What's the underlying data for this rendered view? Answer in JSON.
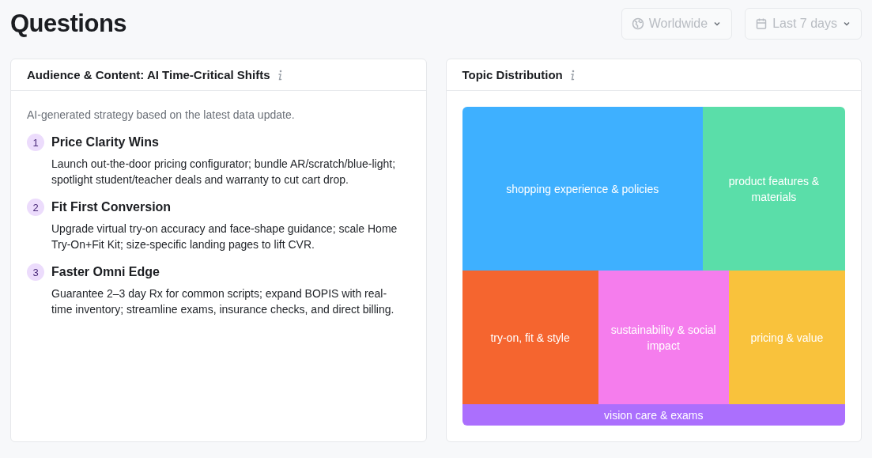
{
  "page_title": "Questions",
  "filters": [
    {
      "kind": "region",
      "label": "Worldwide",
      "disabled": true
    },
    {
      "kind": "date",
      "label": "Last 7 days",
      "disabled": true
    }
  ],
  "strategy_card": {
    "title": "Audience & Content: AI Time-Critical Shifts",
    "intro": "AI-generated strategy based on the latest data update.",
    "items": [
      {
        "number": "1",
        "title": "Price Clarity Wins",
        "text": "Launch out-the-door pricing configurator; bundle AR/scratch/blue-light; spotlight student/teacher deals and warranty to cut cart drop."
      },
      {
        "number": "2",
        "title": "Fit First Conversion",
        "text": "Upgrade virtual try-on accuracy and face-shape guidance; scale Home Try-On+Fit Kit; size-specific landing pages to lift CVR."
      },
      {
        "number": "3",
        "title": "Faster Omni Edge",
        "text": "Guarantee 2–3 day Rx for common scripts; expand BOPIS with real-time inventory; streamline exams, insurance checks, and direct billing."
      }
    ]
  },
  "topic_card": {
    "title": "Topic Distribution",
    "topics": [
      {
        "label": "shopping experience & policies",
        "color": "#3eb0ff"
      },
      {
        "label": "product features & materials",
        "color": "#5adea9"
      },
      {
        "label": "try-on, fit & style",
        "color": "#f5652f"
      },
      {
        "label": "sustainability & social impact",
        "color": "#f57ded"
      },
      {
        "label": "pricing & value",
        "color": "#f9c23c"
      },
      {
        "label": "vision care & exams",
        "color": "#ab6ffd"
      }
    ]
  }
}
